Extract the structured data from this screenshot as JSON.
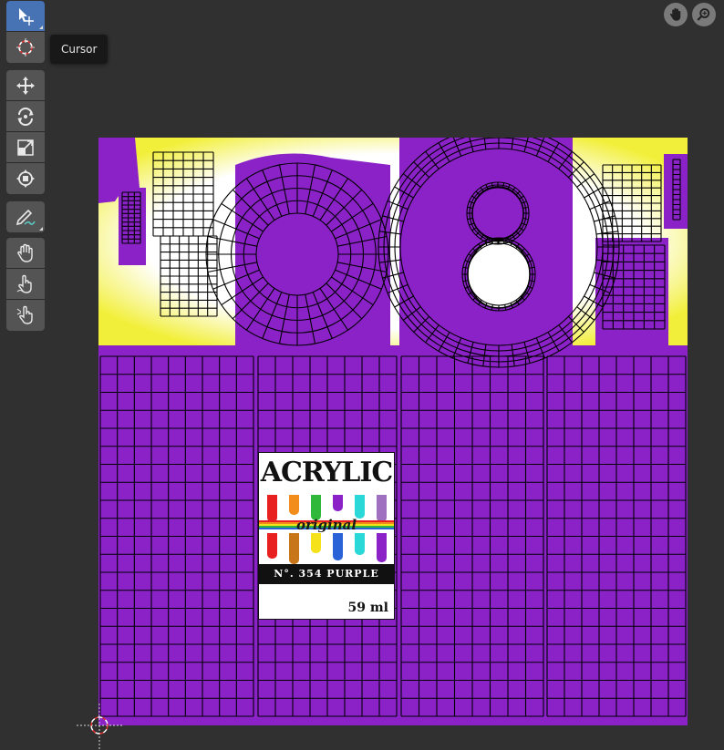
{
  "toolbar": {
    "groups": [
      [
        {
          "name": "select-box-icon",
          "active": true
        },
        {
          "name": "cursor-icon",
          "active": false
        }
      ],
      [
        {
          "name": "move-icon"
        },
        {
          "name": "rotate-icon"
        },
        {
          "name": "scale-icon"
        },
        {
          "name": "transform-icon"
        }
      ],
      [
        {
          "name": "annotate-icon"
        }
      ],
      [
        {
          "name": "grab-icon"
        },
        {
          "name": "relax-icon"
        },
        {
          "name": "pinch-icon"
        }
      ]
    ]
  },
  "tooltip": {
    "text": "Cursor"
  },
  "nav": {
    "pan_icon": "hand-icon",
    "zoom_icon": "zoom-icon"
  },
  "label": {
    "title": "ACRYLIC",
    "subtitle": "original",
    "band": "N°. 354 PURPLE",
    "volume": "59 ml"
  },
  "colors": {
    "background": "#303030",
    "active_tool": "#4772b3",
    "tool": "#545454",
    "texture_purple": "#8a22c8",
    "mesh_wire": "#000000"
  }
}
